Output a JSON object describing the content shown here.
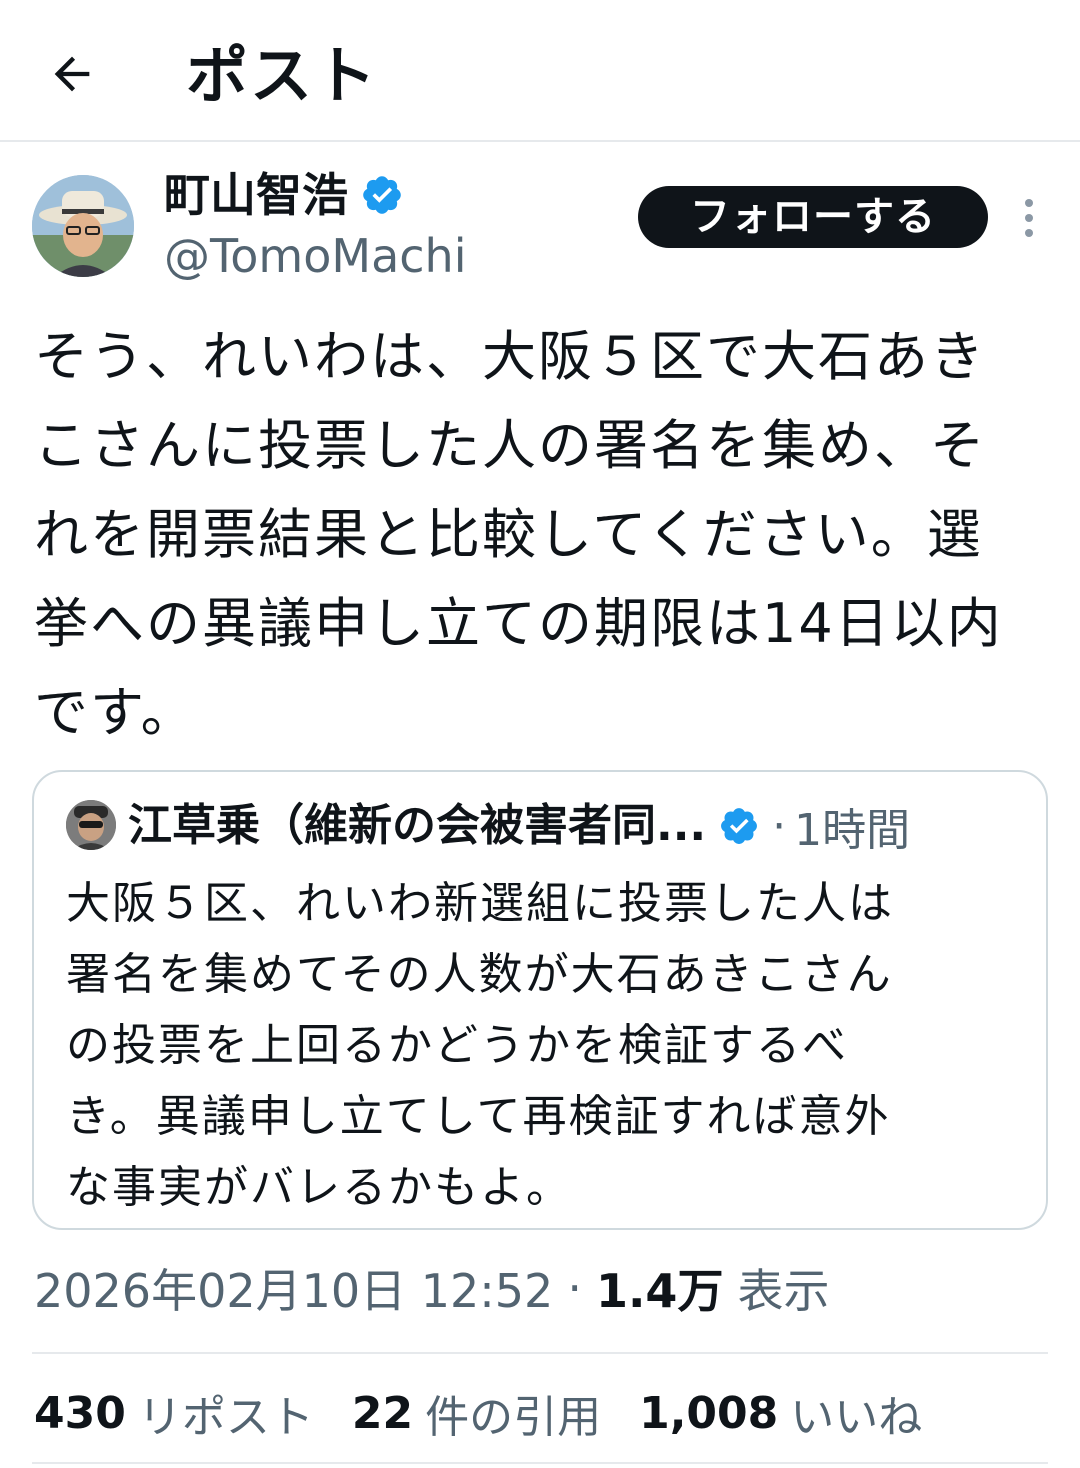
{
  "header": {
    "back_icon": "arrow-left-icon",
    "title": "ポスト"
  },
  "author": {
    "name": "町山智浩",
    "handle": "@TomoMachi",
    "verified_icon": "verified-badge-icon",
    "avatar_icon": "user-avatar"
  },
  "follow_button": {
    "label": "フォローする"
  },
  "more_icon": "more-vertical-icon",
  "post": {
    "text": "そう、れいわは、大阪５区で大石あき\nこさんに投票した人の署名を集め、そ\nれを開票結果と比較してください。選\n挙への異議申し立ての期限は14日以内\nです。"
  },
  "quote": {
    "author_name": "江草乗（維新の会被害者同...",
    "separator": "·",
    "time": "1時間",
    "text": "大阪５区、れいわ新選組に投票した人は\n署名を集めてその人数が大石あきこさん\nの投票を上回るかどうかを検証するべ\nき。異議申し立てして再検証すれば意外\nな事実がバレるかもよ。"
  },
  "meta": {
    "datetime": "2026年02月10日 12:52",
    "separator": "·",
    "views_count": "1.4万",
    "views_label": "表示"
  },
  "stats": [
    {
      "count": "430",
      "label": "リポスト"
    },
    {
      "count": "22",
      "label": "件の引用"
    },
    {
      "count": "1,008",
      "label": "いいね"
    }
  ],
  "colors": {
    "text_primary": "#0f1419",
    "text_secondary": "#536471",
    "verified_blue": "#1d9bf0",
    "border": "#cfd9de",
    "divider": "#e6e9ec"
  }
}
